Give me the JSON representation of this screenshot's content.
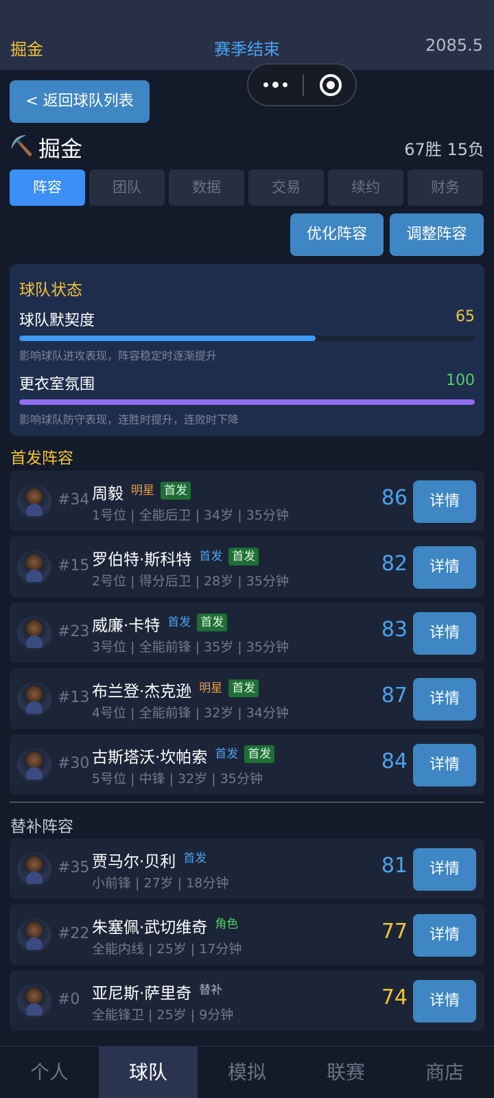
{
  "topbar": {
    "left": "掘金",
    "center": "赛季结束",
    "right": "2085.5"
  },
  "back_label": "< 返回球队列表",
  "team": {
    "icon": "⛏️",
    "name": "掘金",
    "record": "67胜 15负"
  },
  "tabs": [
    {
      "label": "阵容",
      "active": true
    },
    {
      "label": "团队"
    },
    {
      "label": "数据"
    },
    {
      "label": "交易"
    },
    {
      "label": "续约"
    },
    {
      "label": "财务"
    }
  ],
  "actions": {
    "optimize": "优化阵容",
    "adjust": "调整阵容"
  },
  "status": {
    "title": "球队状态",
    "chemistry": {
      "label": "球队默契度",
      "value": "65",
      "desc": "影响球队进攻表现，阵容稳定时逐渐提升"
    },
    "morale": {
      "label": "更衣室氛围",
      "value": "100",
      "desc": "影响球队防守表现，连胜时提升，连败时下降"
    }
  },
  "starters_title": "首发阵容",
  "bench_title": "替补阵容",
  "detail_label": "详情",
  "starters": [
    {
      "number": "#34",
      "name": "周毅",
      "tag": "明星",
      "tag2": "首发",
      "info": "1号位 | 全能后卫 | 34岁 | 35分钟",
      "rating": "86"
    },
    {
      "number": "#15",
      "name": "罗伯特·斯科特",
      "tag": "首发",
      "tag2": "首发",
      "info": "2号位 | 得分后卫 | 28岁 | 35分钟",
      "rating": "82"
    },
    {
      "number": "#23",
      "name": "威廉·卡特",
      "tag": "首发",
      "tag2": "首发",
      "info": "3号位 | 全能前锋 | 35岁 | 35分钟",
      "rating": "83"
    },
    {
      "number": "#13",
      "name": "布兰登·杰克逊",
      "tag": "明星",
      "tag2": "首发",
      "info": "4号位 | 全能前锋 | 32岁 | 34分钟",
      "rating": "87"
    },
    {
      "number": "#30",
      "name": "古斯塔沃·坎帕索",
      "tag": "首发",
      "tag2": "首发",
      "info": "5号位 | 中锋 | 32岁 | 35分钟",
      "rating": "84"
    }
  ],
  "bench": [
    {
      "number": "#35",
      "name": "贾马尔·贝利",
      "tag": "首发",
      "info": "小前锋 | 27岁 | 18分钟",
      "rating": "81"
    },
    {
      "number": "#22",
      "name": "朱塞佩·武切维奇",
      "tag": "角色",
      "info": "全能内线 | 25岁 | 17分钟",
      "rating": "77"
    },
    {
      "number": "#0",
      "name": "亚尼斯·萨里奇",
      "tag": "替补",
      "info": "全能锋卫 | 25岁 | 9分钟",
      "rating": "74"
    }
  ],
  "nav": [
    {
      "label": "个人"
    },
    {
      "label": "球队",
      "active": true
    },
    {
      "label": "模拟"
    },
    {
      "label": "联赛"
    },
    {
      "label": "商店"
    }
  ],
  "colors": {
    "accent_gold": "#f4c430",
    "accent_blue": "#4aa3f0",
    "chemistry_bar": "#3b9bf5",
    "morale_bar": "#8f6cf0",
    "morale_value": "#4fd06a"
  }
}
